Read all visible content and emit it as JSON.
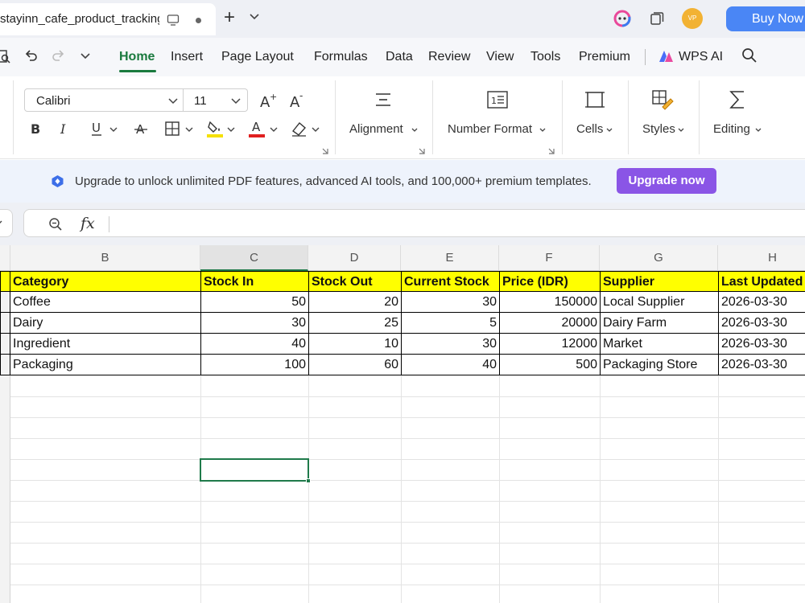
{
  "tabbar": {
    "doc_title": "stayinn_cafe_product_tracking",
    "avatar_initials": "VP",
    "buy_now_label": "Buy Now"
  },
  "menu": {
    "items": [
      "Home",
      "Insert",
      "Page Layout",
      "Formulas",
      "Data",
      "Review",
      "View",
      "Tools",
      "Premium"
    ],
    "wps_ai_label": "WPS AI",
    "active": "Home"
  },
  "ribbon": {
    "font_name": "Calibri",
    "font_size": "11",
    "groups": {
      "alignment": "Alignment",
      "number_format": "Number Format",
      "cells": "Cells",
      "styles": "Styles",
      "editing": "Editing"
    },
    "colors": {
      "highlight": "#f5e000",
      "font_color": "#e02020"
    }
  },
  "banner": {
    "text": "Upgrade to unlock unlimited PDF features, advanced AI tools, and 100,000+ premium templates.",
    "button_label": "Upgrade now"
  },
  "formula_bar": {
    "fx_label": "fx",
    "content": ""
  },
  "sheet": {
    "columns": [
      "B",
      "C",
      "D",
      "E",
      "F",
      "G",
      "H"
    ],
    "selected_column": "C",
    "headers": [
      "Category",
      "Stock In",
      "Stock Out",
      "Current Stock",
      "Price (IDR)",
      "Supplier",
      "Last Updated"
    ],
    "rows": [
      [
        "Coffee",
        "50",
        "20",
        "30",
        "150000",
        "Local Supplier",
        "2026-03-30"
      ],
      [
        "Dairy",
        "30",
        "25",
        "5",
        "20000",
        "Dairy Farm",
        "2026-03-30"
      ],
      [
        "Ingredient",
        "40",
        "10",
        "30",
        "12000",
        "Market",
        "2026-03-30"
      ],
      [
        "Packaging",
        "100",
        "60",
        "40",
        "500",
        "Packaging Store",
        "2026-03-30"
      ]
    ],
    "header_fill": "#ffff00",
    "selection_color": "#1f7a4a"
  }
}
